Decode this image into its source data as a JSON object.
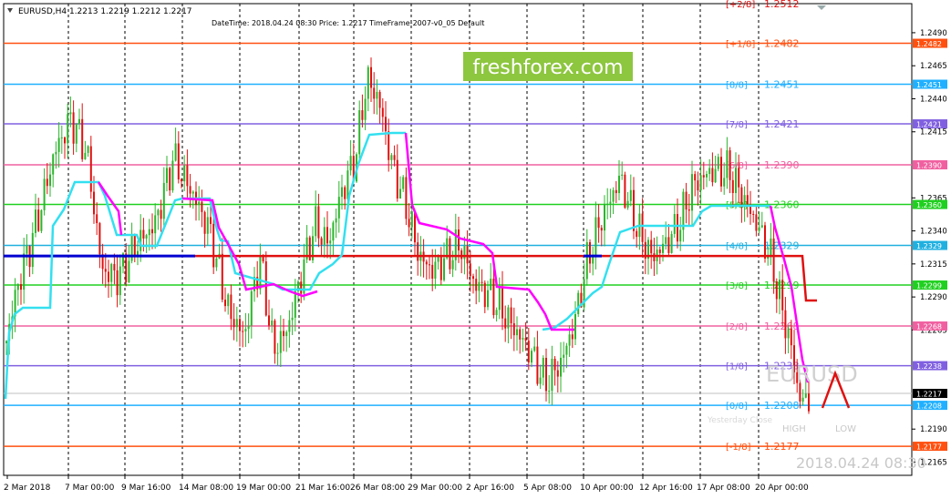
{
  "header": {
    "symbol_info": "EURUSD,H4  1.2213 1.2219 1.2212 1.2217",
    "info": "DateTime: 2018.04.24 08:30    Price: 1.2217    TimeFrame-2007-v0_05    Default"
  },
  "watermark": {
    "brand": "freshforex.com",
    "symbol": "EURUSD",
    "date": "2018.04.24 08:30",
    "yesterday": "Yesterday Close",
    "high": "HIGH",
    "low": "LOW"
  },
  "colors": {
    "bull": "#2db52d",
    "bear": "#e01010",
    "magenta": "#ff00ff",
    "cyan": "#33e0f0",
    "brand_bg": "#8dc63f"
  },
  "chart_data": {
    "type": "candlestick",
    "ylim": [
      1.2155,
      1.2512
    ],
    "price_ticks": [
      "1.2490",
      "1.2465",
      "1.2440",
      "1.2415",
      "1.2365",
      "1.2340",
      "1.2315",
      "1.2290",
      "1.2265",
      "1.2190",
      "1.2165"
    ],
    "x_ticks": [
      "2 Mar 2018",
      "7 Mar 00:00",
      "9 Mar 16:00",
      "14 Mar 08:00",
      "19 Mar 00:00",
      "21 Mar 16:00",
      "26 Mar 08:00",
      "29 Mar 00:00",
      "2 Apr 16:00",
      "5 Apr 08:00",
      "10 Apr 00:00",
      "12 Apr 16:00",
      "17 Apr 08:00",
      "20 Apr 00:00"
    ],
    "current_price": "1.2217",
    "murrey_levels": [
      {
        "label": "[+2/8]",
        "value": "1.2512",
        "color": "#e01010"
      },
      {
        "label": "[+1/8]",
        "value": "1.2482",
        "color": "#ff5010"
      },
      {
        "label": "[8/8]",
        "value": "1.2451",
        "color": "#20b0ff"
      },
      {
        "label": "[7/8]",
        "value": "1.2421",
        "color": "#8060e0"
      },
      {
        "label": "[6/8]",
        "value": "1.2390",
        "color": "#f060a0"
      },
      {
        "label": "[5/8]",
        "value": "1.2360",
        "color": "#20d020"
      },
      {
        "label": "[4/8]",
        "value": "1.2329",
        "color": "#20b0e0"
      },
      {
        "label": "[3/8]",
        "value": "1.2299",
        "color": "#20d020"
      },
      {
        "label": "[2/8]",
        "value": "1.2268",
        "color": "#f060a0"
      },
      {
        "label": "[1/8]",
        "value": "1.2238",
        "color": "#8060e0"
      },
      {
        "label": "[0/8]",
        "value": "1.2208",
        "color": "#20b0ff"
      },
      {
        "label": "[-1/8]",
        "value": "1.2177",
        "color": "#ff5010"
      }
    ],
    "blue_line": 1.2321,
    "red_line": 1.2321
  }
}
